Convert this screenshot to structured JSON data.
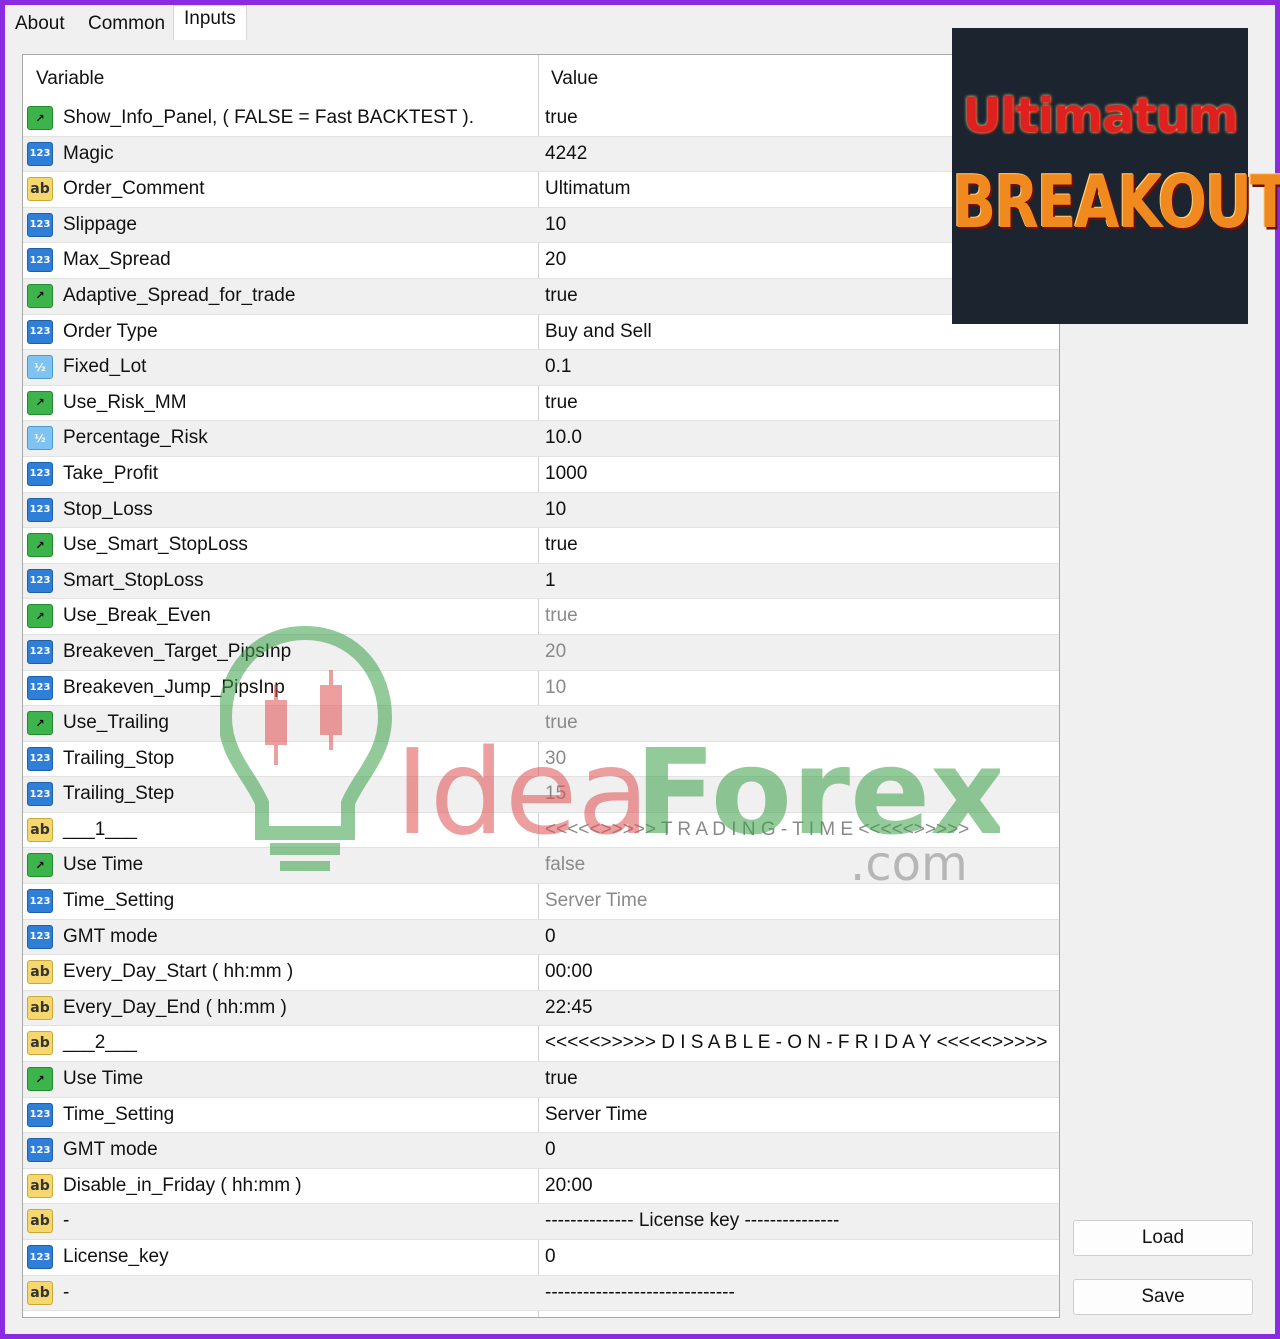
{
  "tabs": [
    "About",
    "Common",
    "Inputs"
  ],
  "columns": {
    "variable": "Variable",
    "value": "Value"
  },
  "logo": {
    "line1": "Ultimatum",
    "line2": "BREAKOUT"
  },
  "watermark": {
    "brand_a": "Idea",
    "brand_b": "Forex",
    "suffix": ".com"
  },
  "buttons": {
    "load": "Load",
    "save": "Save"
  },
  "rows": [
    {
      "type": "bool",
      "name": "Show_Info_Panel, ( FALSE = Fast BACKTEST ).",
      "value": "true"
    },
    {
      "type": "int",
      "name": "Magic",
      "value": "4242"
    },
    {
      "type": "str",
      "name": "Order_Comment",
      "value": "Ultimatum"
    },
    {
      "type": "int",
      "name": "Slippage",
      "value": "10"
    },
    {
      "type": "int",
      "name": "Max_Spread",
      "value": "20"
    },
    {
      "type": "bool",
      "name": "Adaptive_Spread_for_trade",
      "value": "true"
    },
    {
      "type": "int",
      "name": "Order Type",
      "value": "Buy and Sell"
    },
    {
      "type": "dbl",
      "name": "Fixed_Lot",
      "value": "0.1"
    },
    {
      "type": "bool",
      "name": "Use_Risk_MM",
      "value": "true"
    },
    {
      "type": "dbl",
      "name": "Percentage_Risk",
      "value": "10.0"
    },
    {
      "type": "int",
      "name": "Take_Profit",
      "value": "1000"
    },
    {
      "type": "int",
      "name": "Stop_Loss",
      "value": "10"
    },
    {
      "type": "bool",
      "name": "Use_Smart_StopLoss",
      "value": "true"
    },
    {
      "type": "int",
      "name": "Smart_StopLoss",
      "value": "1"
    },
    {
      "type": "bool",
      "name": "Use_Break_Even",
      "value": "true",
      "dim": true
    },
    {
      "type": "int",
      "name": "Breakeven_Target_PipsInp",
      "value": "20",
      "dim": true
    },
    {
      "type": "int",
      "name": "Breakeven_Jump_PipsInp",
      "value": "10",
      "dim": true
    },
    {
      "type": "bool",
      "name": "Use_Trailing",
      "value": "true",
      "dim": true
    },
    {
      "type": "int",
      "name": "Trailing_Stop",
      "value": "30",
      "dim": true
    },
    {
      "type": "int",
      "name": "Trailing_Step",
      "value": "15",
      "dim": true
    },
    {
      "type": "str",
      "name": "___1___",
      "value": "<<<<<>>>>> T R A D I N G - T I M E <<<<<>>>>>",
      "dim": true
    },
    {
      "type": "bool",
      "name": "Use Time",
      "value": "false",
      "dim": true
    },
    {
      "type": "int",
      "name": "Time_Setting",
      "value": "Server Time",
      "dim": true
    },
    {
      "type": "int",
      "name": "GMT mode",
      "value": "0"
    },
    {
      "type": "str",
      "name": "Every_Day_Start ( hh:mm )",
      "value": "00:00"
    },
    {
      "type": "str",
      "name": "Every_Day_End ( hh:mm )",
      "value": "22:45"
    },
    {
      "type": "str",
      "name": "___2___",
      "value": "<<<<<>>>>> D I S A B L E - O N - F R I D A Y <<<<<>>>>>"
    },
    {
      "type": "bool",
      "name": "Use Time",
      "value": "true"
    },
    {
      "type": "int",
      "name": "Time_Setting",
      "value": "Server Time"
    },
    {
      "type": "int",
      "name": "GMT mode",
      "value": "0"
    },
    {
      "type": "str",
      "name": "Disable_in_Friday ( hh:mm )",
      "value": "20:00"
    },
    {
      "type": "str",
      "name": "-",
      "value": "-------------- License key ---------------"
    },
    {
      "type": "int",
      "name": "License_key",
      "value": "0"
    },
    {
      "type": "str",
      "name": "-",
      "value": "------------------------------"
    }
  ],
  "icon_glyphs": {
    "bool": "↗",
    "int": "123",
    "str": "ab",
    "dbl": "½"
  },
  "colors": {
    "frame": "#8a2be2",
    "bool_icon": "#3cb44b",
    "int_icon": "#2f7fd8",
    "str_icon": "#f5d76e",
    "dbl_icon": "#7fc4f0"
  }
}
